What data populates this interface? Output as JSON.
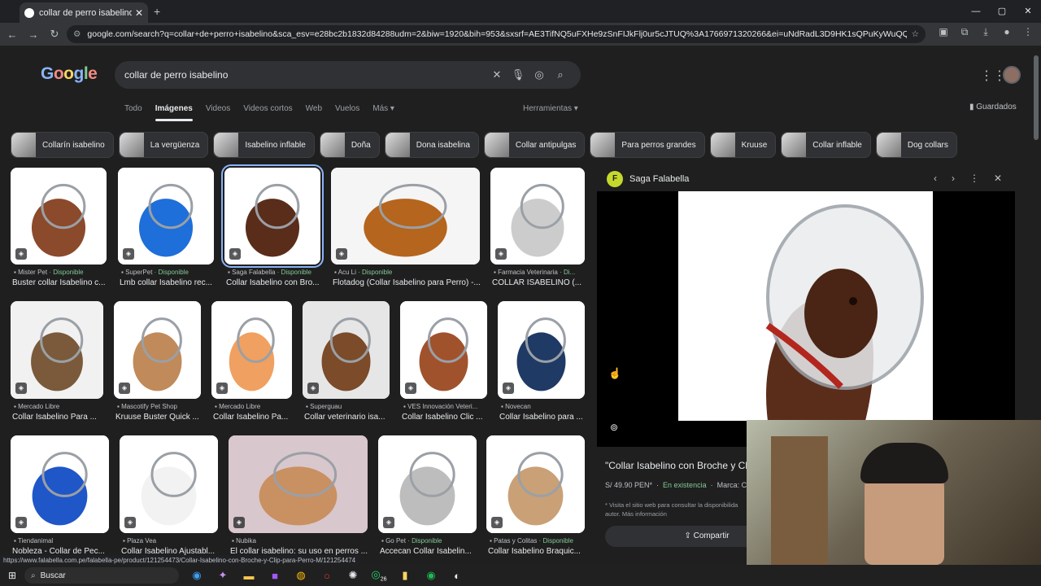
{
  "browser": {
    "tab_title": "collar de perro isabelino - Busc",
    "tab_close": "✕",
    "new_tab": "+",
    "window_controls": [
      "—",
      "▢",
      "✕"
    ],
    "url": "google.com/search?q=collar+de+perro+isabelino&sca_esv=e28bc2b1832d84288udm=2&biw=1920&bih=953&sxsrf=AE3TifNQ5uFXHe9zSnFIJkFlj0ur5cJTUQ%3A1766971320266&ei=uNdRadL3D9HK1sQPuKyWuQQ&oq=collar+de+perro+isa...",
    "status_url": "https://www.falabella.com.pe/falabella-pe/product/121254473/Collar-Isabelino-con-Broche-y-Clip-para-Perro-M/121254474"
  },
  "header": {
    "logo_letters": [
      "G",
      "o",
      "o",
      "g",
      "l",
      "e"
    ],
    "search_query": "collar de perro isabelino",
    "saved_label": "Guardados",
    "tools_label": "Herramientas ▾"
  },
  "search_tabs": [
    {
      "label": "Todo",
      "active": false
    },
    {
      "label": "Imágenes",
      "active": true
    },
    {
      "label": "Videos",
      "active": false
    },
    {
      "label": "Videos cortos",
      "active": false
    },
    {
      "label": "Web",
      "active": false
    },
    {
      "label": "Vuelos",
      "active": false
    },
    {
      "label": "Más ▾",
      "active": false
    }
  ],
  "chips": [
    "Collarín isabelino",
    "La vergüenza",
    "Isabelino inflable",
    "Doña",
    "Dona isabelina",
    "Collar antipulgas",
    "Para perros grandes",
    "Kruuse",
    "Collar inflable",
    "Dog collars"
  ],
  "results": [
    {
      "source": "Mister Pet",
      "avail": "Disponible",
      "caption": "Buster collar Isabelino c..."
    },
    {
      "source": "SuperPet",
      "avail": "Disponible",
      "caption": "Lmb collar Isabelino rec..."
    },
    {
      "source": "Saga Falabella",
      "avail": "Disponible",
      "caption": "Collar Isabelino con Bro..."
    },
    {
      "source": "Acu Li",
      "avail": "Disponible",
      "caption": "Flotadog (Collar Isabelino para Perro) -..."
    },
    {
      "source": "Farmacia Veterinaria",
      "avail": "Di...",
      "caption": "COLLAR ISABELINO (..."
    },
    {
      "source": "Mercado Libre",
      "avail": "",
      "caption": "Collar Isabelino Para ..."
    },
    {
      "source": "Mascotify Pet Shop",
      "avail": "",
      "caption": "Kruuse Buster Quick ..."
    },
    {
      "source": "Mercado Libre",
      "avail": "",
      "caption": "Collar Isabelino Pa..."
    },
    {
      "source": "Superguau",
      "avail": "",
      "caption": "Collar veterinario isa..."
    },
    {
      "source": "VES Innovación Veteri...",
      "avail": "",
      "caption": "Collar Isabelino Clic ..."
    },
    {
      "source": "Novecan",
      "avail": "",
      "caption": "Collar Isabelino para ..."
    },
    {
      "source": "Tiendanimal",
      "avail": "",
      "caption": "Nobleza - Collar de Pec..."
    },
    {
      "source": "Plaza Vea",
      "avail": "",
      "caption": "Collar Isabelino Ajustabl..."
    },
    {
      "source": "Nubika",
      "avail": "",
      "caption": "El collar isabelino: su uso en perros ..."
    },
    {
      "source": "Go Pet",
      "avail": "Disponible",
      "caption": "Accecan Collar Isabelin..."
    },
    {
      "source": "Patas y Colitas",
      "avail": "Disponible",
      "caption": "Collar Isabelino Braquic..."
    }
  ],
  "panel": {
    "site_initial": "F",
    "site_name": "Saga Falabella",
    "title": "\"Collar Isabelino con Broche y Cl",
    "price": "S/ 49.90 PEN*",
    "stock": "En existencia",
    "brand": "Marca: C",
    "note": "* Visita el sitio web para consultar la disponibilida autor. Más información",
    "share_label": "Compartir"
  },
  "taskbar": {
    "search_label": "Buscar",
    "whatsapp_badge": "26"
  },
  "colors": {
    "accent": "#8ab4f8",
    "available": "#81c995"
  }
}
